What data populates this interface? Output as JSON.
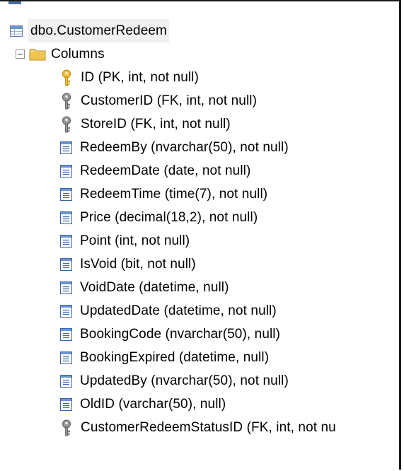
{
  "tree": {
    "table": {
      "label": "dbo.CustomerRedeem",
      "icon": "table-icon"
    },
    "columns_folder": {
      "label": "Columns",
      "expanded": true,
      "icon": "folder-icon"
    },
    "columns": [
      {
        "label": "ID (PK, int, not null)",
        "icon": "primary-key-icon"
      },
      {
        "label": "CustomerID (FK, int, not null)",
        "icon": "foreign-key-icon"
      },
      {
        "label": "StoreID (FK, int, not null)",
        "icon": "foreign-key-icon"
      },
      {
        "label": "RedeemBy (nvarchar(50), not null)",
        "icon": "column-icon"
      },
      {
        "label": "RedeemDate (date, not null)",
        "icon": "column-icon"
      },
      {
        "label": "RedeemTime (time(7), not null)",
        "icon": "column-icon"
      },
      {
        "label": "Price (decimal(18,2), not null)",
        "icon": "column-icon"
      },
      {
        "label": "Point (int, not null)",
        "icon": "column-icon"
      },
      {
        "label": "IsVoid (bit, not null)",
        "icon": "column-icon"
      },
      {
        "label": "VoidDate (datetime, null)",
        "icon": "column-icon"
      },
      {
        "label": "UpdatedDate (datetime, not null)",
        "icon": "column-icon"
      },
      {
        "label": "BookingCode (nvarchar(50), null)",
        "icon": "column-icon"
      },
      {
        "label": "BookingExpired (datetime, null)",
        "icon": "column-icon"
      },
      {
        "label": "UpdatedBy (nvarchar(50), not null)",
        "icon": "column-icon"
      },
      {
        "label": "OldID (varchar(50), null)",
        "icon": "column-icon"
      },
      {
        "label": "CustomerRedeemStatusID (FK, int, not nu",
        "icon": "foreign-key-icon"
      }
    ]
  },
  "colors": {
    "primary_key": "#e8b81e",
    "foreign_key": "#8a8a8a",
    "column_icon": "#3a66a8",
    "folder": "#e9c35a",
    "selection_bg": "#f0f0f0"
  }
}
